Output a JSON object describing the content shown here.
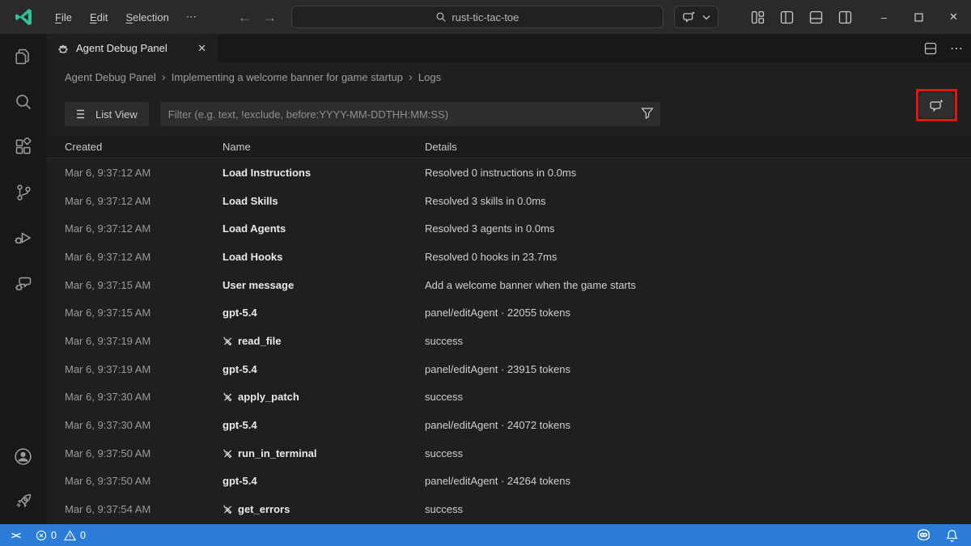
{
  "titlebar": {
    "menus": [
      {
        "label": "File"
      },
      {
        "label": "Edit"
      },
      {
        "label": "Selection"
      }
    ],
    "search": {
      "value": "rust-tic-tac-toe"
    }
  },
  "tab": {
    "label": "Agent Debug Panel"
  },
  "breadcrumbs": {
    "items": [
      "Agent Debug Panel",
      "Implementing a welcome banner for game startup",
      "Logs"
    ]
  },
  "toolbar": {
    "list_view_label": "List View",
    "filter_placeholder": "Filter (e.g. text, !exclude, before:YYYY-MM-DDTHH:MM:SS)"
  },
  "table": {
    "headers": [
      "Created",
      "Name",
      "Details"
    ],
    "rows": [
      {
        "created": "Mar 6, 9:37:12 AM",
        "name": "Load Instructions",
        "tool": false,
        "details": "Resolved 0 instructions in 0.0ms"
      },
      {
        "created": "Mar 6, 9:37:12 AM",
        "name": "Load Skills",
        "tool": false,
        "details": "Resolved 3 skills in 0.0ms"
      },
      {
        "created": "Mar 6, 9:37:12 AM",
        "name": "Load Agents",
        "tool": false,
        "details": "Resolved 3 agents in 0.0ms"
      },
      {
        "created": "Mar 6, 9:37:12 AM",
        "name": "Load Hooks",
        "tool": false,
        "details": "Resolved 0 hooks in 23.7ms"
      },
      {
        "created": "Mar 6, 9:37:15 AM",
        "name": "User message",
        "tool": false,
        "details": "Add a welcome banner when the game starts"
      },
      {
        "created": "Mar 6, 9:37:15 AM",
        "name": "gpt-5.4",
        "tool": false,
        "details": "panel/editAgent · 22055 tokens"
      },
      {
        "created": "Mar 6, 9:37:19 AM",
        "name": "read_file",
        "tool": true,
        "details": "success"
      },
      {
        "created": "Mar 6, 9:37:19 AM",
        "name": "gpt-5.4",
        "tool": false,
        "details": "panel/editAgent · 23915 tokens"
      },
      {
        "created": "Mar 6, 9:37:30 AM",
        "name": "apply_patch",
        "tool": true,
        "details": "success"
      },
      {
        "created": "Mar 6, 9:37:30 AM",
        "name": "gpt-5.4",
        "tool": false,
        "details": "panel/editAgent · 24072 tokens"
      },
      {
        "created": "Mar 6, 9:37:50 AM",
        "name": "run_in_terminal",
        "tool": true,
        "details": "success"
      },
      {
        "created": "Mar 6, 9:37:50 AM",
        "name": "gpt-5.4",
        "tool": false,
        "details": "panel/editAgent · 24264 tokens"
      },
      {
        "created": "Mar 6, 9:37:54 AM",
        "name": "get_errors",
        "tool": true,
        "details": "success"
      }
    ]
  },
  "status_bar": {
    "errors": "0",
    "warnings": "0"
  },
  "icons": {
    "menu_overflow": "⋯",
    "back_arrow": "←",
    "forward_arrow": "→",
    "minimize": "–",
    "close": "✕",
    "tab_close": "✕",
    "breadcrumb_separator": "›",
    "editor_more": "⋯",
    "remote": "><"
  },
  "colors": {
    "status_bar": "#2b7cd9",
    "logo_accent": "#35bf97",
    "highlight_red": "#e21414",
    "editor_bg": "#1f1f1f",
    "titlebar_bg": "#2a2a2b",
    "rail_bg": "#181818"
  }
}
